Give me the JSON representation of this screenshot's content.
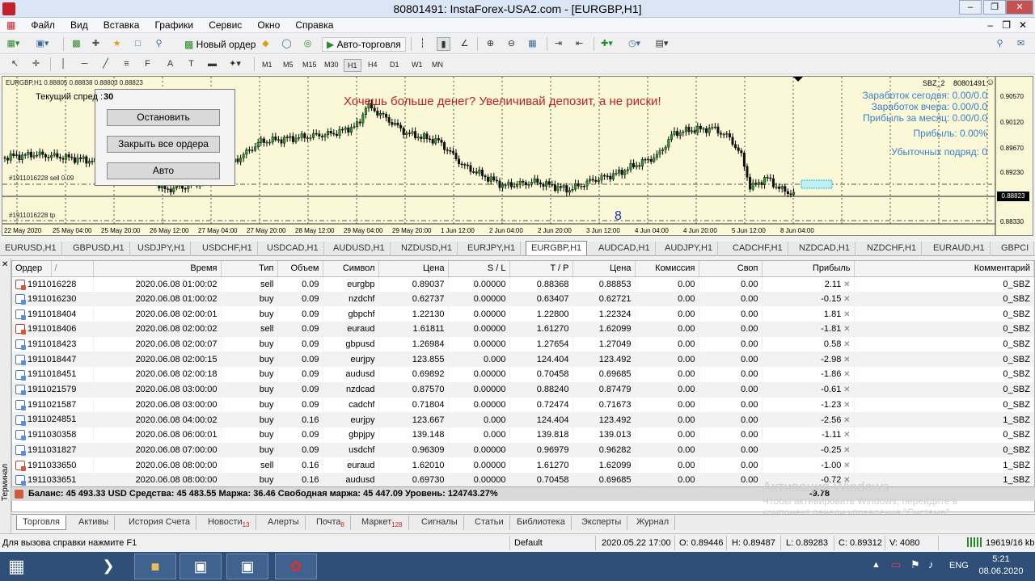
{
  "window": {
    "title": "80801491: InstaForex-USA2.com - [EURGBP,H1]"
  },
  "menu": [
    "Файл",
    "Вид",
    "Вставка",
    "Графики",
    "Сервис",
    "Окно",
    "Справка"
  ],
  "toolbar": {
    "new_order": "Новый ордер",
    "auto_trading": "Авто-торговля"
  },
  "timeframes": [
    "M1",
    "M5",
    "M15",
    "M30",
    "H1",
    "H4",
    "D1",
    "W1",
    "MN"
  ],
  "timeframe_selected": "H1",
  "chart": {
    "header": "EURGBP,H1  0.88805 0.88838 0.88803 0.88823",
    "banner": "Хочешь больше денег? Увеличивай депозит, а не риски!",
    "spread_label": "Текущий спред :",
    "spread_value": "30",
    "ea_name": "SBZ_2",
    "account": "80801491",
    "stats": [
      "Заработок сегодня: 0.00/0.0",
      "Заработок вчера: 0.00/0.0",
      "Прибыль за месяц: 0.00/0.0",
      "Прибыль: 0.00%",
      "Убыточных подряд: 0"
    ],
    "sell_label": "#1911016228 sell 0.09",
    "tp_label": "#1911016228 tp",
    "marker": "8",
    "price_ticks": [
      "0.90570",
      "0.90120",
      "0.89670",
      "0.89230",
      "0.88823",
      "0.88330"
    ],
    "current_price": "0.88823",
    "time_ticks": [
      "22 May 2020",
      "25 May 04:00",
      "25 May 20:00",
      "26 May 12:00",
      "27 May 04:00",
      "27 May 20:00",
      "28 May 12:00",
      "29 May 04:00",
      "29 May 20:00",
      "1 Jun 12:00",
      "2 Jun 04:00",
      "2 Jun 20:00",
      "3 Jun 12:00",
      "4 Jun 04:00",
      "4 Jun 20:00",
      "5 Jun 12:00",
      "8 Jun 04:00"
    ],
    "grid": true
  },
  "dialog": {
    "stop": "Остановить",
    "close_all": "Закрыть все ордера",
    "auto": "Авто"
  },
  "symbol_tabs": [
    "EURUSD,H1",
    "GBPUSD,H1",
    "USDJPY,H1",
    "USDCHF,H1",
    "USDCAD,H1",
    "AUDUSD,H1",
    "NZDUSD,H1",
    "EURJPY,H1",
    "EURGBP,H1",
    "AUDCAD,H1",
    "AUDJPY,H1",
    "CADCHF,H1",
    "NZDCAD,H1",
    "NZDCHF,H1",
    "EURAUD,H1",
    "GBPCI"
  ],
  "symbol_tab_active": "EURGBP,H1",
  "orders": {
    "columns": [
      "Ордер",
      "/",
      "Время",
      "Тип",
      "Объем",
      "Символ",
      "Цена",
      "S / L",
      "T / P",
      "Цена",
      "Комиссия",
      "Своп",
      "Прибыль",
      "Комментарий"
    ],
    "rows": [
      [
        "1911016228",
        "2020.06.08 01:00:02",
        "sell",
        "0.09",
        "eurgbp",
        "0.89037",
        "0.00000",
        "0.88368",
        "0.88853",
        "0.00",
        "0.00",
        "2.11",
        "0_SBZ"
      ],
      [
        "1911016230",
        "2020.06.08 01:00:02",
        "buy",
        "0.09",
        "nzdchf",
        "0.62737",
        "0.00000",
        "0.63407",
        "0.62721",
        "0.00",
        "0.00",
        "-0.15",
        "0_SBZ"
      ],
      [
        "1911018404",
        "2020.06.08 02:00:01",
        "buy",
        "0.09",
        "gbpchf",
        "1.22130",
        "0.00000",
        "1.22800",
        "1.22324",
        "0.00",
        "0.00",
        "1.81",
        "0_SBZ"
      ],
      [
        "1911018406",
        "2020.06.08 02:00:02",
        "sell",
        "0.09",
        "euraud",
        "1.61811",
        "0.00000",
        "1.61270",
        "1.62099",
        "0.00",
        "0.00",
        "-1.81",
        "0_SBZ"
      ],
      [
        "1911018423",
        "2020.06.08 02:00:07",
        "buy",
        "0.09",
        "gbpusd",
        "1.26984",
        "0.00000",
        "1.27654",
        "1.27049",
        "0.00",
        "0.00",
        "0.58",
        "0_SBZ"
      ],
      [
        "1911018447",
        "2020.06.08 02:00:15",
        "buy",
        "0.09",
        "eurjpy",
        "123.855",
        "0.000",
        "124.404",
        "123.492",
        "0.00",
        "0.00",
        "-2.98",
        "0_SBZ"
      ],
      [
        "1911018451",
        "2020.06.08 02:00:18",
        "buy",
        "0.09",
        "audusd",
        "0.69892",
        "0.00000",
        "0.70458",
        "0.69685",
        "0.00",
        "0.00",
        "-1.86",
        "0_SBZ"
      ],
      [
        "1911021579",
        "2020.06.08 03:00:00",
        "buy",
        "0.09",
        "nzdcad",
        "0.87570",
        "0.00000",
        "0.88240",
        "0.87479",
        "0.00",
        "0.00",
        "-0.61",
        "0_SBZ"
      ],
      [
        "1911021587",
        "2020.06.08 03:00:00",
        "buy",
        "0.09",
        "cadchf",
        "0.71804",
        "0.00000",
        "0.72474",
        "0.71673",
        "0.00",
        "0.00",
        "-1.23",
        "0_SBZ"
      ],
      [
        "1911024851",
        "2020.06.08 04:00:02",
        "buy",
        "0.16",
        "eurjpy",
        "123.667",
        "0.000",
        "124.404",
        "123.492",
        "0.00",
        "0.00",
        "-2.56",
        "1_SBZ"
      ],
      [
        "1911030358",
        "2020.06.08 06:00:01",
        "buy",
        "0.09",
        "gbpjpy",
        "139.148",
        "0.000",
        "139.818",
        "139.013",
        "0.00",
        "0.00",
        "-1.11",
        "0_SBZ"
      ],
      [
        "1911031827",
        "2020.06.08 07:00:00",
        "buy",
        "0.09",
        "usdchf",
        "0.96309",
        "0.00000",
        "0.96979",
        "0.96282",
        "0.00",
        "0.00",
        "-0.25",
        "0_SBZ"
      ],
      [
        "1911033650",
        "2020.06.08 08:00:00",
        "sell",
        "0.16",
        "euraud",
        "1.62010",
        "0.00000",
        "1.61270",
        "1.62099",
        "0.00",
        "0.00",
        "-1.00",
        "1_SBZ"
      ],
      [
        "1911033651",
        "2020.06.08 08:00:00",
        "buy",
        "0.16",
        "audusd",
        "0.69730",
        "0.00000",
        "0.70458",
        "0.69685",
        "0.00",
        "0.00",
        "-0.72",
        "1_SBZ"
      ]
    ]
  },
  "balance_line": "Баланс: 45 493.33 USD  Средства: 45 483.55  Маржа: 36.46  Свободная маржа: 45 447.09  Уровень: 124743.27%",
  "total_profit": "-9.78",
  "terminal_label": "Терминал",
  "bottom_tabs": [
    {
      "label": "Торговля",
      "badge": ""
    },
    {
      "label": "Активы",
      "badge": ""
    },
    {
      "label": "История Счета",
      "badge": ""
    },
    {
      "label": "Новости",
      "badge": "13"
    },
    {
      "label": "Алерты",
      "badge": ""
    },
    {
      "label": "Почта",
      "badge": "8"
    },
    {
      "label": "Маркет",
      "badge": "128"
    },
    {
      "label": "Сигналы",
      "badge": ""
    },
    {
      "label": "Статьи",
      "badge": ""
    },
    {
      "label": "Библиотека",
      "badge": ""
    },
    {
      "label": "Эксперты",
      "badge": ""
    },
    {
      "label": "Журнал",
      "badge": ""
    }
  ],
  "status": {
    "help": "Для вызова справки нажмите F1",
    "profile": "Default",
    "datetime": "2020.05.22 17:00",
    "open": "O: 0.89446",
    "high": "H: 0.89487",
    "low": "L: 0.89283",
    "close": "C: 0.89312",
    "volume": "V: 4080",
    "traffic": "19619/16 kb"
  },
  "watermark": {
    "line1": "Активация Windows",
    "line2": "Чтобы активировать Windows, перейдите в",
    "line3": "компонент панели управления \"Система\"."
  },
  "taskbar": {
    "lang": "ENG",
    "time": "5:21",
    "date": "08.06.2020"
  }
}
